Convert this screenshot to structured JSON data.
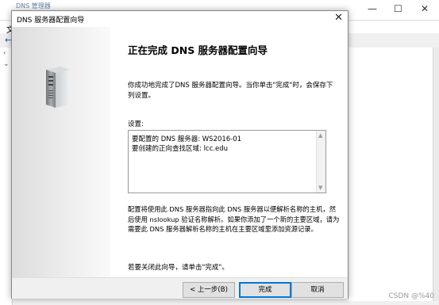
{
  "background_window": {
    "title": "DNS 管理器",
    "menu_letter": "文",
    "back_arrow": "←",
    "minimize_glyph": "—",
    "maximize_glyph": "☐",
    "close_glyph": "✕",
    "tree_glyph_1": "‹",
    "tree_glyph_2": "⌄",
    "watermark": "CSDN @%40"
  },
  "dialog": {
    "title": "DNS 服务器配置向导",
    "close_glyph": "✕",
    "heading": "正在完成 DNS 服务器配置向导",
    "intro": "你成功地完成了DNS 服务器配置向导。当你单击\"完成\"时，会保存下列设置。",
    "settings_label": "设置:",
    "settings_lines": [
      "要配置的 DNS 服务器: WS2016-01",
      "要创建的正向查找区域: lcc.edu"
    ],
    "info": "配置将使用此 DNS 服务器指向此 DNS 服务器以便解析名称的主机，然后使用 nslookup 验证名称解析。如果你添加了一个新的主要区域，请为需要此 DNS 服务器解析名称的主机在主要区域里添加资源记录。",
    "closing": "若要关闭此向导，请单击\"完成\"。",
    "buttons": {
      "back": "< 上一步(B)",
      "finish": "完成",
      "cancel": "取消"
    }
  },
  "icons": {
    "server": "server-tower-icon"
  }
}
